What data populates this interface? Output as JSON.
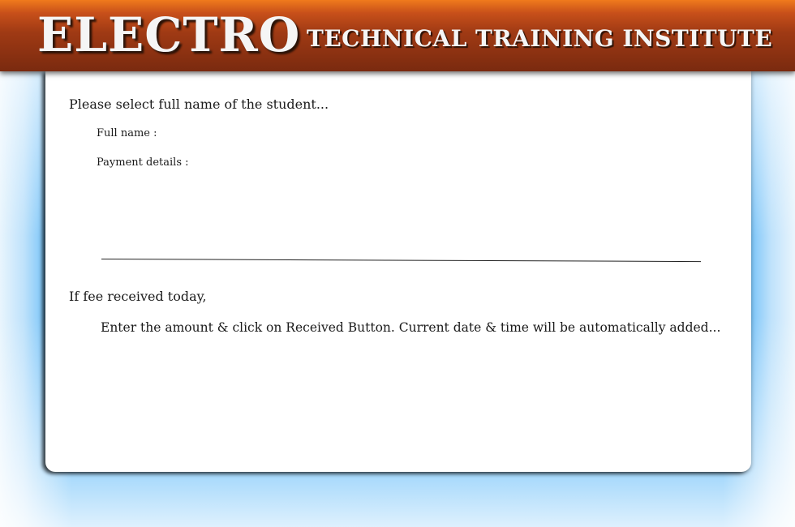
{
  "header": {
    "brand": "ELECTRO",
    "tagline": "TECHNICAL TRAINING INSTITUTE"
  },
  "form": {
    "prompt": "Please select full name of the student...",
    "full_name_label": "Full name :",
    "payment_details_label": "Payment details :",
    "fee_heading": "If fee received today,",
    "fee_instruction": "Enter the amount & click on Received Button. Current date & time will be automatically added..."
  },
  "colors": {
    "header_top": "#f07a1c",
    "header_bottom": "#7a2a0f",
    "background_blue": "#1f9ef6",
    "panel": "#ffffff"
  }
}
